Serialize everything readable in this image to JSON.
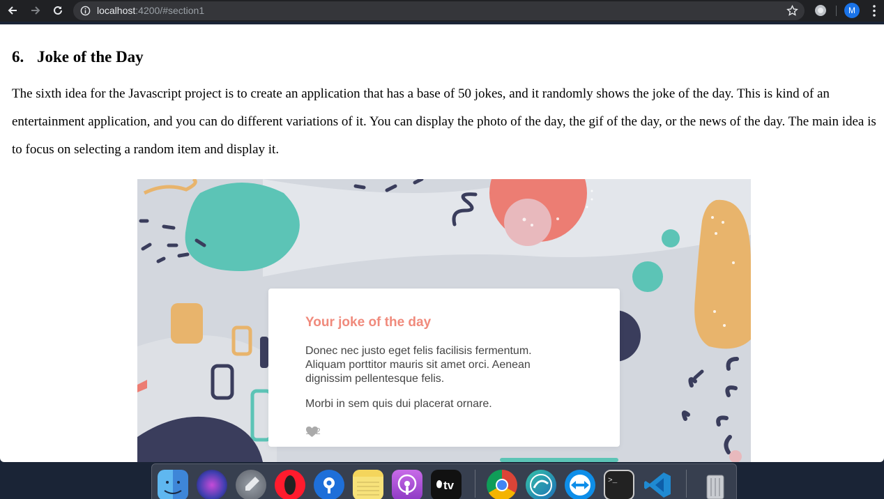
{
  "browser": {
    "url_host": "localhost",
    "url_rest": ":4200/#section1",
    "avatar_letter": "M",
    "accent": "#1a73e8"
  },
  "article": {
    "section_number": "6.",
    "section_title": "Joke of the Day",
    "paragraph": "The sixth idea for the Javascript project is to create an application that has a base of 50 jokes, and it randomly shows the joke of the day. This is kind of an entertainment application, and you can do different variations of it. You can display the photo of the day, the gif of the day, or the news of the day. The main idea is to focus on selecting a random item and display it."
  },
  "joke_card": {
    "title": "Your joke of the day",
    "body": "Donec nec justo eget felis facilisis fermentum. Aliquam porttitor mauris sit amet orci. Aenean dignissim pellentesque felis.",
    "body2": "Morbi in sem quis dui placerat ornare.",
    "likes": "192",
    "title_color": "#f08a7c"
  },
  "dock": {
    "apps": [
      "finder-icon",
      "siri-icon",
      "launchpad-icon",
      "opera-icon",
      "sourcetree-icon",
      "notes-icon",
      "podcasts-icon",
      "apple-tv-icon",
      "chrome-icon",
      "edge-icon",
      "teamviewer-icon",
      "terminal-icon",
      "vscode-icon",
      "trash-icon"
    ],
    "tv_label": "tv",
    "terminal_prompt": ">_"
  }
}
